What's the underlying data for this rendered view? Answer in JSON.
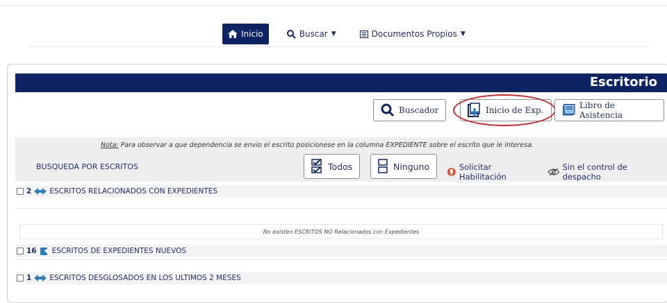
{
  "nav": {
    "home_label": "Inicio",
    "search_label": "Buscar",
    "docs_label": "Documentos Propios"
  },
  "panel": {
    "title": "Escritorio",
    "buttons": {
      "buscador": "Buscador",
      "inicio_exp": "Inicio de Exp.",
      "libro": "Libro de Asistencia"
    },
    "nota_prefix": "Nota:",
    "nota_text": " Para observar a que dependencia se envio el escrito posicionese en la columna EXPEDIENTE sobre el escrito que le interesa.",
    "busqueda_label": "BUSQUEDA POR ESCRITOS",
    "todos_label": "Todos",
    "ninguno_label": "Ninguno",
    "solicitar_label": "Solicitar Habilitación",
    "sin_control_label": "Sin el control de despacho"
  },
  "sections": [
    {
      "count": "2",
      "label": "ESCRITOS RELACIONADOS CON EXPEDIENTES"
    },
    {
      "count": "16",
      "label": "ESCRITOS DE EXPEDIENTES NUEVOS"
    },
    {
      "count": "1",
      "label": "ESCRITOS DESGLOSADOS EN LOS ULTIMOS 2 MESES"
    }
  ],
  "empty_message": "No existen ESCRITOS NO Relacionados con Expedientes",
  "colors": {
    "navy": "#0d2363",
    "highlight": "#d6222a",
    "icon_blue": "#2b7bbf",
    "alert": "#e64a2f"
  }
}
